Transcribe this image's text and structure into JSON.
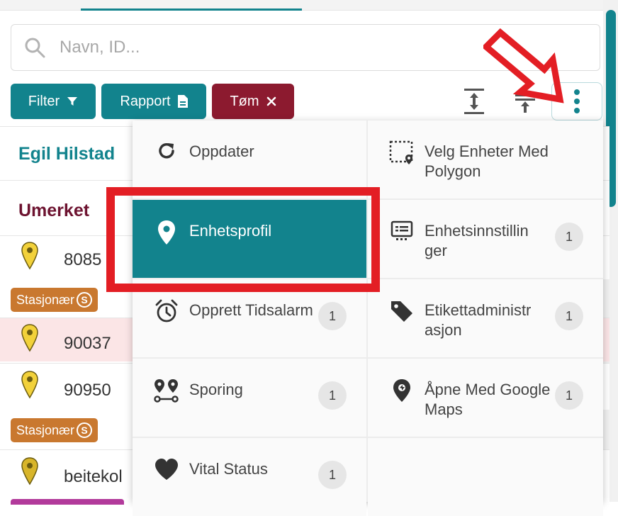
{
  "search": {
    "placeholder": "Navn, ID..."
  },
  "toolbar": {
    "filter_label": "Filter",
    "rapport_label": "Rapport",
    "tom_label": "Tøm",
    "icons": [
      "filter-icon",
      "document-icon",
      "close-icon",
      "expand-rows-icon",
      "collapse-rows-icon",
      "kebab-menu-icon"
    ]
  },
  "left_list": {
    "group_1": "Egil Hilstad",
    "group_2": "Umerket",
    "units": [
      {
        "id": "8085"
      },
      {
        "id": "90037"
      },
      {
        "id": "90950"
      },
      {
        "id": "beitekol"
      }
    ],
    "badge_label": "Stasjonær",
    "badge_count": "S"
  },
  "menu": {
    "oppdater": "Oppdater",
    "velg_polygon": "Velg Enheter Med Polygon",
    "enhetsprofil": "Enhetsprofil",
    "enhetsinnstillinger": "Enhetsinnstillin ger",
    "enhetsinnstillinger_count": "1",
    "tidsalarm": "Opprett Tidsalarm",
    "tidsalarm_count": "1",
    "etikett": "Etikettadministr asjon",
    "etikett_count": "1",
    "sporing": "Sporing",
    "sporing_count": "1",
    "google_maps": "Åpne Med Google Maps",
    "google_maps_count": "1",
    "vital_status": "Vital Status",
    "vital_status_count": "1"
  },
  "colors": {
    "teal": "#12838d",
    "maroon": "#8c1a2f",
    "orange_badge": "#c9782f",
    "highlight_red": "#e31e24"
  }
}
